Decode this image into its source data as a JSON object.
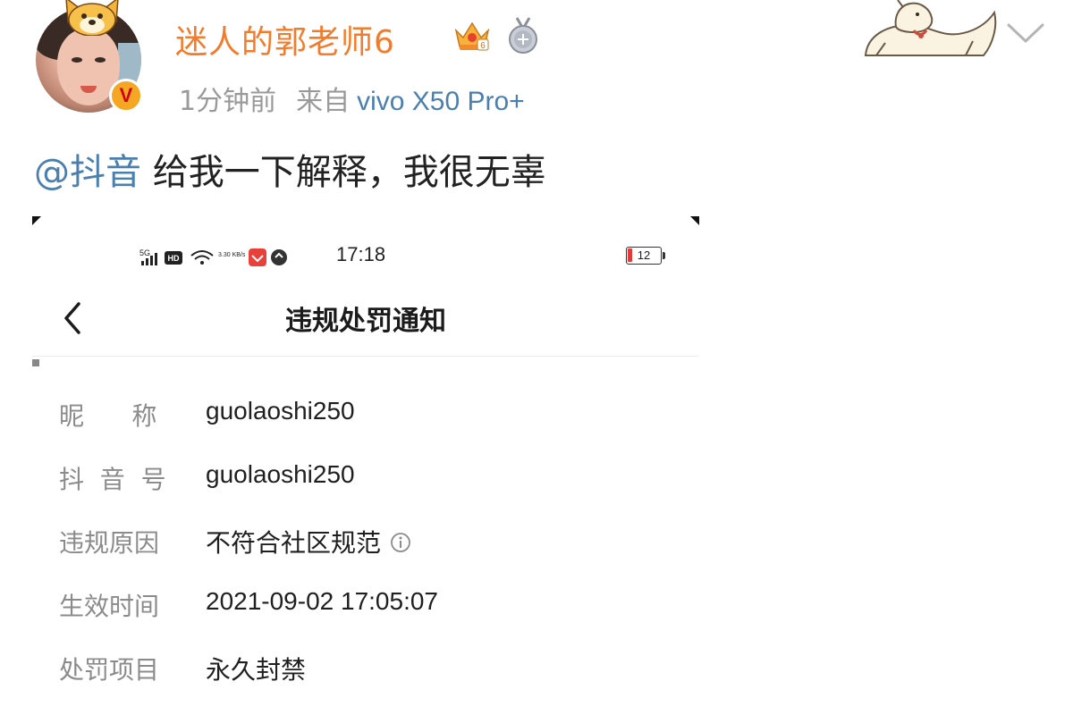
{
  "post": {
    "username": "迷人的郭老师6",
    "time": "1分钟前",
    "from_label": "来自",
    "device": "vivo X50 Pro+",
    "mention": "@抖音",
    "text": " 给我一下解释，我很无辜",
    "icons": {
      "verified": "v-badge-icon",
      "crown": "crown-level-icon",
      "medal": "medal-icon",
      "menu": "chevron-down-icon"
    },
    "verified_label": "V",
    "colors": {
      "username": "#f57b2a",
      "link": "#4a7fb0",
      "meta": "#9a9a9a"
    }
  },
  "screenshot": {
    "status_bar": {
      "time": "17:18",
      "battery": "12",
      "network": "5G",
      "hd": "HD",
      "speed": "3.30 KB/s"
    },
    "title": "违规处罚通知",
    "rows": [
      {
        "label": "昵      称",
        "value": "guolaoshi250"
      },
      {
        "label": "抖  音  号",
        "value": "guolaoshi250"
      },
      {
        "label": "违规原因",
        "value": "不符合社区规范"
      },
      {
        "label": "生效时间",
        "value": "2021-09-02 17:05:07"
      },
      {
        "label": "处罚项目",
        "value": "永久封禁"
      }
    ]
  }
}
